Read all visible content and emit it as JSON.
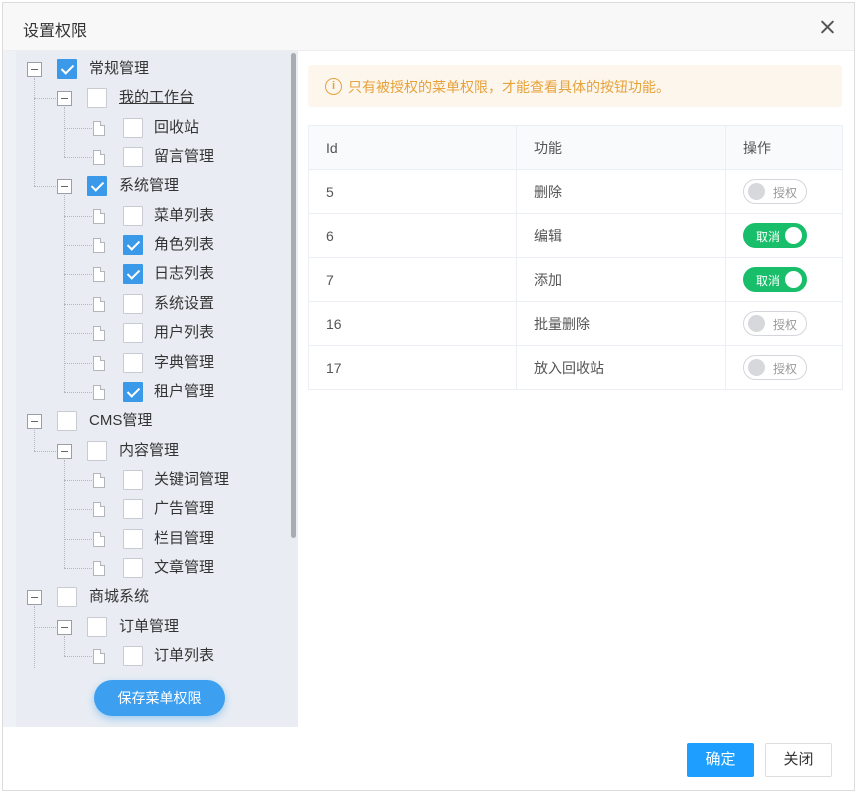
{
  "dialog": {
    "title": "设置权限",
    "ok_label": "确定",
    "close_label": "关闭"
  },
  "tree": {
    "save_label": "保存菜单权限",
    "nodes": [
      {
        "label": "常规管理",
        "checked": true
      },
      {
        "label": "我的工作台",
        "checked": false
      },
      {
        "label": "回收站",
        "checked": false
      },
      {
        "label": "留言管理",
        "checked": false
      },
      {
        "label": "系统管理",
        "checked": true
      },
      {
        "label": "菜单列表",
        "checked": false
      },
      {
        "label": "角色列表",
        "checked": true
      },
      {
        "label": "日志列表",
        "checked": true
      },
      {
        "label": "系统设置",
        "checked": false
      },
      {
        "label": "用户列表",
        "checked": false
      },
      {
        "label": "字典管理",
        "checked": false
      },
      {
        "label": "租户管理",
        "checked": true
      },
      {
        "label": "CMS管理",
        "checked": false
      },
      {
        "label": "内容管理",
        "checked": false
      },
      {
        "label": "关键词管理",
        "checked": false
      },
      {
        "label": "广告管理",
        "checked": false
      },
      {
        "label": "栏目管理",
        "checked": false
      },
      {
        "label": "文章管理",
        "checked": false
      },
      {
        "label": "商城系统",
        "checked": false
      },
      {
        "label": "订单管理",
        "checked": false
      },
      {
        "label": "订单列表",
        "checked": false
      }
    ]
  },
  "notice": {
    "icon": "info-icon",
    "icon_glyph": "i",
    "text": "只有被授权的菜单权限，才能查看具体的按钮功能。",
    "color": "#e6a23c"
  },
  "table": {
    "headers": [
      "Id",
      "功能",
      "操作"
    ],
    "rows": [
      {
        "id": "5",
        "name": "删除",
        "switch_label": "授权",
        "on": false
      },
      {
        "id": "6",
        "name": "编辑",
        "switch_label": "取消",
        "on": true
      },
      {
        "id": "7",
        "name": "添加",
        "switch_label": "取消",
        "on": true
      },
      {
        "id": "16",
        "name": "批量删除",
        "switch_label": "授权",
        "on": false
      },
      {
        "id": "17",
        "name": "放入回收站",
        "switch_label": "授权",
        "on": false
      }
    ]
  },
  "colors": {
    "accent": "#3a99e8",
    "switch_on": "#19be6b",
    "ok_button": "#1e9fff"
  }
}
